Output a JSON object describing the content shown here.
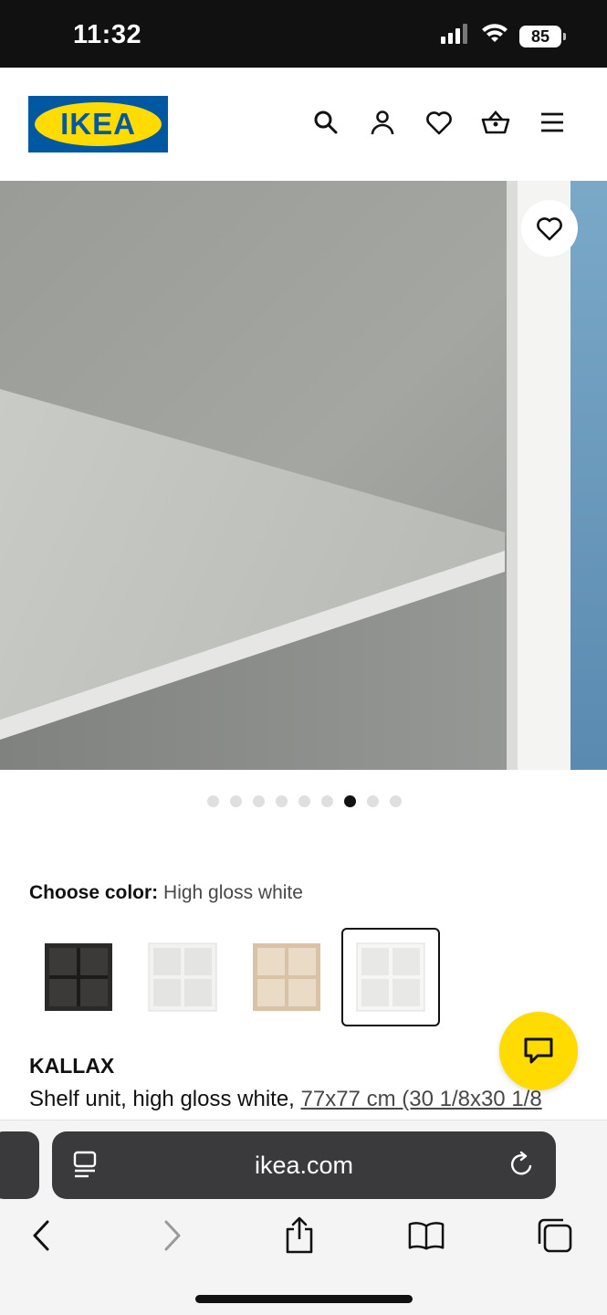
{
  "status_bar": {
    "time": "11:32",
    "battery": "85"
  },
  "header": {
    "logo_text": "IKEA",
    "icons": [
      "search-icon",
      "account-icon",
      "heart-icon",
      "basket-icon",
      "menu-icon"
    ]
  },
  "gallery": {
    "total_images": 9,
    "active_index": 6
  },
  "color_chooser": {
    "label": "Choose color:",
    "selected_value": "High gloss white",
    "options": [
      "black-brown",
      "white",
      "white-stained oak",
      "high gloss white"
    ]
  },
  "product": {
    "name": "KALLAX",
    "description_prefix": "Shelf unit, high gloss white, ",
    "dimensions": "77x77 cm (30 1/8x30 1/8"
  },
  "browser": {
    "url": "ikea.com"
  },
  "colors": {
    "ikea_blue": "#0058a3",
    "ikea_yellow": "#ffdb00"
  }
}
